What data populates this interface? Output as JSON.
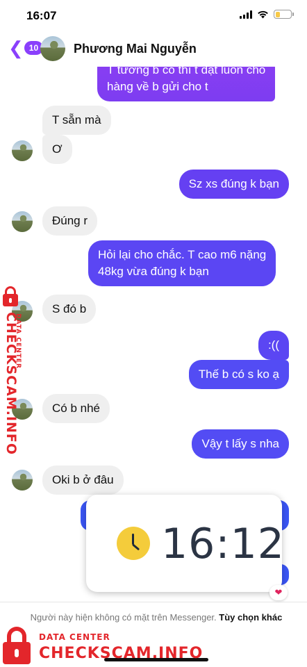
{
  "status_bar": {
    "time": "16:07"
  },
  "header": {
    "unread_count": "10",
    "contact_name": "Phương Mai Nguyễn"
  },
  "messages": [
    {
      "side": "out",
      "text_line1": "T tưởng b có thì t đặt luôn cho",
      "text_line2": "hàng về b gửi cho t"
    },
    {
      "side": "in",
      "text": "T sẵn mà"
    },
    {
      "side": "in",
      "text": "Ơ"
    },
    {
      "side": "out",
      "text": "Sz xs đúng k bạn"
    },
    {
      "side": "in",
      "text": "Đúng r"
    },
    {
      "side": "out",
      "text_line1": "Hỏi lại cho chắc. T cao m6 nặng",
      "text_line2": "48kg vừa đúng k bạn"
    },
    {
      "side": "in",
      "text": "S đó b"
    },
    {
      "side": "out",
      "text": ":(("
    },
    {
      "side": "out",
      "text": "Thế b có s ko ạ"
    },
    {
      "side": "in",
      "text": "Có b nhé"
    },
    {
      "side": "out",
      "text": "Vậy t lấy s nha"
    },
    {
      "side": "in",
      "text": "Oki b ở đâu"
    }
  ],
  "clock_overlay": {
    "time": "16:12",
    "icon": "clock-icon"
  },
  "reaction": {
    "icon": "heart-icon",
    "glyph": "❤"
  },
  "footer": {
    "note": "Người này hiện không có mặt trên Messenger.",
    "link": "Tùy chọn khác"
  },
  "watermarks": {
    "small": "DATA CENTER",
    "big": "CHECKSCAM.INFO"
  },
  "colors": {
    "accent": "#8a3ffc",
    "outgoing_top": "#8b3ef2",
    "outgoing_bottom": "#534cf4",
    "incoming": "#efefef",
    "watermark": "#e3262b"
  }
}
